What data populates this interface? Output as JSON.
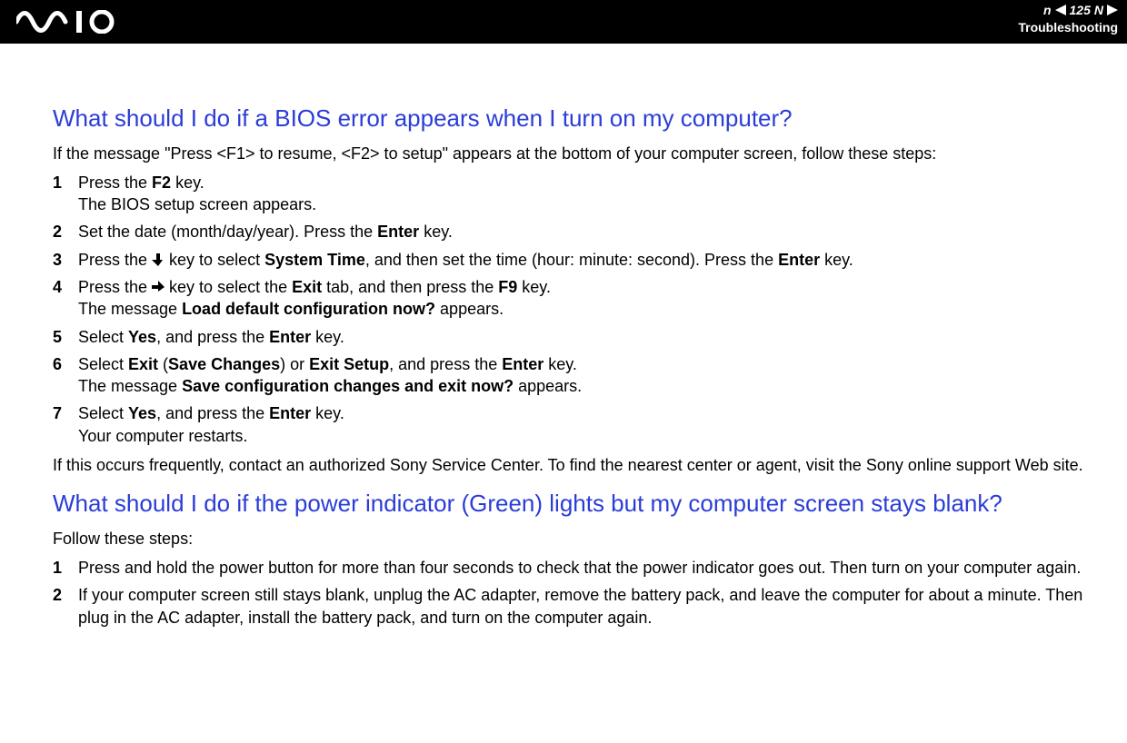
{
  "header": {
    "page_number": "125",
    "n_label": "n",
    "N_label": "N",
    "section": "Troubleshooting"
  },
  "q1": {
    "title": "What should I do if a BIOS error appears when I turn on my computer?",
    "intro": "If the message \"Press <F1> to resume, <F2> to setup\" appears at the bottom of your computer screen, follow these steps:",
    "steps": {
      "s1n": "1",
      "s1a": "Press the ",
      "s1b": "F2",
      "s1c": " key.",
      "s1d": "The BIOS setup screen appears.",
      "s2n": "2",
      "s2a": "Set the date (month/day/year). Press the ",
      "s2b": "Enter",
      "s2c": " key.",
      "s3n": "3",
      "s3a": "Press the ",
      "s3b": " key to select ",
      "s3c": "System Time",
      "s3d": ", and then set the time (hour: minute: second). Press the ",
      "s3e": "Enter",
      "s3f": " key.",
      "s4n": "4",
      "s4a": "Press the ",
      "s4b": " key to select the ",
      "s4c": "Exit",
      "s4d": " tab, and then press the ",
      "s4e": "F9",
      "s4f": " key.",
      "s4g": "The message ",
      "s4h": "Load default configuration now?",
      "s4i": " appears.",
      "s5n": "5",
      "s5a": "Select ",
      "s5b": "Yes",
      "s5c": ", and press the ",
      "s5d": "Enter",
      "s5e": " key.",
      "s6n": "6",
      "s6a": "Select ",
      "s6b": "Exit",
      "s6c": " (",
      "s6d": "Save Changes",
      "s6e": ") or ",
      "s6f": "Exit Setup",
      "s6g": ", and press the ",
      "s6h": "Enter",
      "s6i": " key.",
      "s6j": "The message ",
      "s6k": "Save configuration changes and exit now?",
      "s6l": " appears.",
      "s7n": "7",
      "s7a": "Select ",
      "s7b": "Yes",
      "s7c": ", and press the ",
      "s7d": "Enter",
      "s7e": " key.",
      "s7f": "Your computer restarts."
    },
    "after": "If this occurs frequently, contact an authorized Sony Service Center. To find the nearest center or agent, visit the Sony online support Web site."
  },
  "q2": {
    "title": "What should I do if the power indicator (Green) lights but my computer screen stays blank?",
    "intro": "Follow these steps:",
    "steps": {
      "s1n": "1",
      "s1": "Press and hold the power button for more than four seconds to check that the power indicator goes out. Then turn on your computer again.",
      "s2n": "2",
      "s2": "If your computer screen still stays blank, unplug the AC adapter, remove the battery pack, and leave the computer for about a minute. Then plug in the AC adapter, install the battery pack, and turn on the computer again."
    }
  }
}
